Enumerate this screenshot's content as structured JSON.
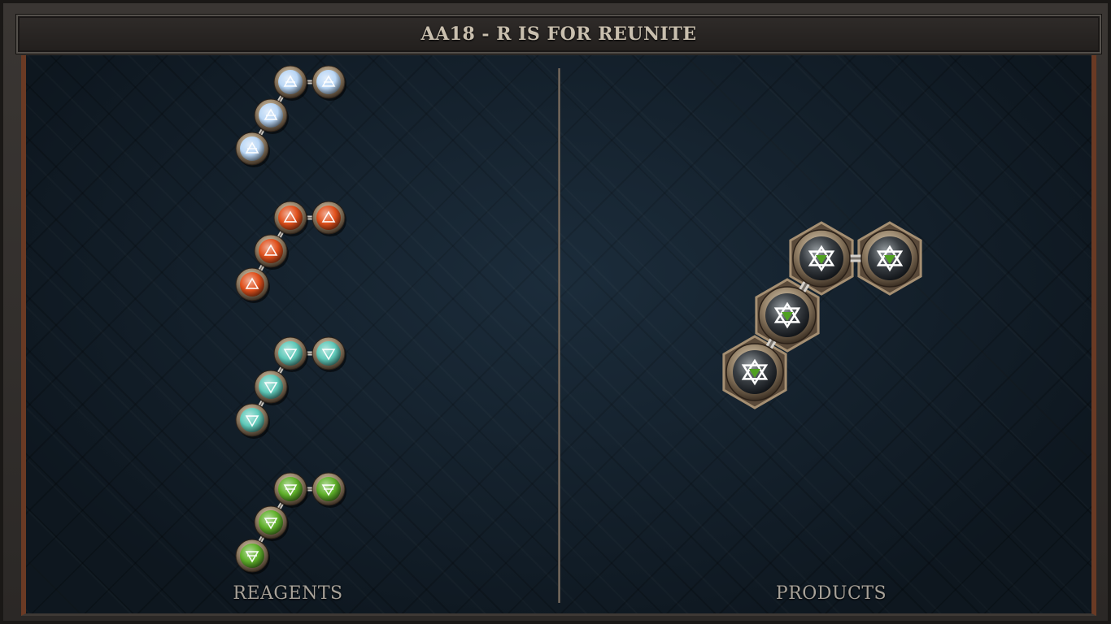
{
  "header": {
    "title": "AA18 - R IS FOR REUNITE"
  },
  "reagents_pane": {
    "label": "REAGENTS",
    "molecules": [
      {
        "element": "air-icon",
        "color": "#b9d6f5",
        "atoms": 4
      },
      {
        "element": "fire-icon",
        "color": "#e0501c",
        "atoms": 4
      },
      {
        "element": "water-icon",
        "color": "#5fc9b9",
        "atoms": 4
      },
      {
        "element": "earth-icon",
        "color": "#5fb02a",
        "atoms": 4
      }
    ]
  },
  "products_pane": {
    "label": "PRODUCTS",
    "molecules": [
      {
        "element": "quintessence-icon",
        "atoms": 4
      }
    ]
  },
  "colors": {
    "board_bg": "#152330",
    "frame_accent": "#6a3a24",
    "text": "#c9bfae"
  }
}
